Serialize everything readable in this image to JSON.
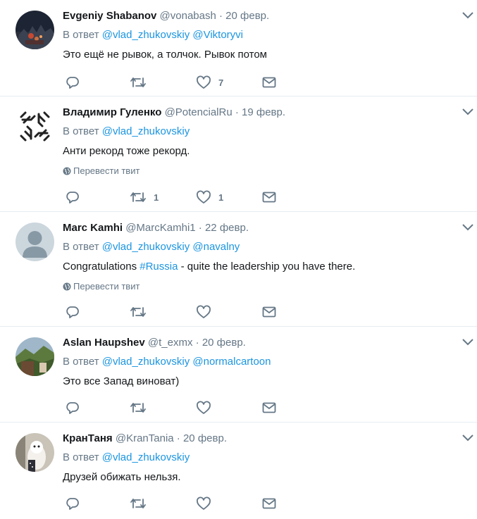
{
  "tweets": [
    {
      "name": "Evgeniy Shabanov",
      "handle": "@vonabash",
      "date": "20 февр.",
      "reply_prefix": "В ответ",
      "mentions": [
        "@vlad_zhukovskiy",
        "@Viktoryvi"
      ],
      "text": "Это ещё не рывок, а толчок. Рывок потом",
      "translate": "",
      "counts": {
        "reply": "",
        "retweet": "",
        "like": "7"
      },
      "avatar": "avatar-photo-night-city"
    },
    {
      "name": "Владимир Гуленко",
      "handle": "@PotencialRu",
      "date": "19 февр.",
      "reply_prefix": "В ответ",
      "mentions": [
        "@vlad_zhukovskiy"
      ],
      "text": "Анти рекорд тоже рекорд.",
      "translate": "Перевести твит",
      "counts": {
        "reply": "",
        "retweet": "1",
        "like": "1"
      },
      "avatar": "avatar-hands-logo"
    },
    {
      "name": "Marc Kamhi",
      "handle": "@MarcKamhi1",
      "date": "22 февр.",
      "reply_prefix": "В ответ",
      "mentions": [
        "@vlad_zhukovskiy",
        "@navalny"
      ],
      "text_before": "Congratulations ",
      "hashtag": "#Russia",
      "text_after": " - quite the leadership you have there.",
      "translate": "Перевести твит",
      "counts": {
        "reply": "",
        "retweet": "",
        "like": ""
      },
      "avatar": "avatar-default-silhouette"
    },
    {
      "name": "Aslan Haupshev",
      "handle": "@t_exmx",
      "date": "20 февр.",
      "reply_prefix": "В ответ",
      "mentions": [
        "@vlad_zhukovskiy",
        "@normalcartoon"
      ],
      "text": "Это все Запад виноват)",
      "translate": "",
      "counts": {
        "reply": "",
        "retweet": "",
        "like": ""
      },
      "avatar": "avatar-photo-mountains"
    },
    {
      "name": "КранТаня",
      "handle": "@KranTania",
      "date": "20 февр.",
      "reply_prefix": "В ответ",
      "mentions": [
        "@vlad_zhukovskiy"
      ],
      "text": "Друзей обижать нельзя.",
      "translate": "",
      "counts": {
        "reply": "",
        "retweet": "",
        "like": ""
      },
      "avatar": "avatar-photo-dog"
    }
  ],
  "colors": {
    "link": "#1b95e0",
    "muted": "#657786",
    "text": "#14171a",
    "border": "#e6ecf0"
  },
  "icons": [
    "reply-icon",
    "retweet-icon",
    "like-icon",
    "direct-message-icon",
    "chevron-down-icon",
    "globe-icon"
  ]
}
